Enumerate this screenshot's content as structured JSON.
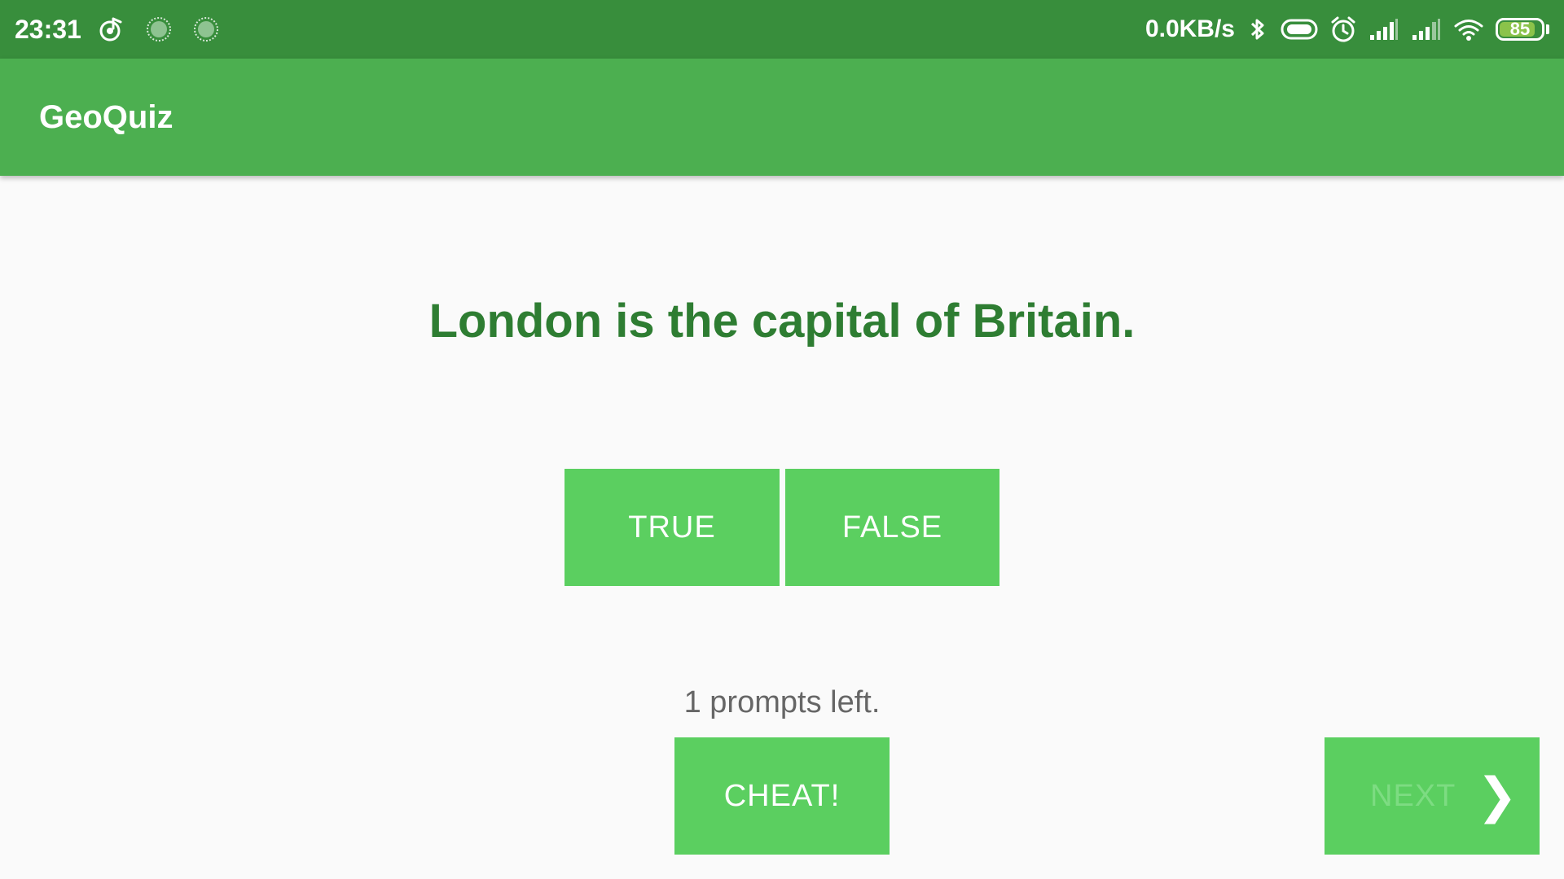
{
  "status_bar": {
    "time": "23:31",
    "network_speed": "0.0KB/s",
    "battery_level": "85",
    "left_icons": [
      "music-note-icon",
      "loading-spinner-icon",
      "loading-spinner-icon"
    ],
    "right_icons": [
      "bluetooth-icon",
      "toggle-icon",
      "alarm-clock-icon",
      "signal-icon",
      "signal-icon",
      "wifi-icon",
      "battery-icon"
    ],
    "colors": {
      "background": "#388e3c",
      "battery_fill": "#8bc34a"
    }
  },
  "app_bar": {
    "title": "GeoQuiz",
    "color": "#4caf50"
  },
  "quiz": {
    "question": "London is the capital of Britain.",
    "true_label": "TRUE",
    "false_label": "FALSE",
    "prompts_left": "1 prompts left.",
    "cheat_label": "CHEAT!",
    "next_label": "NEXT",
    "next_icon": "chevron-right-icon",
    "colors": {
      "button": "#5bcf60",
      "question_text": "#2e7d32",
      "next_text_disabled": "#7ddc82"
    }
  }
}
